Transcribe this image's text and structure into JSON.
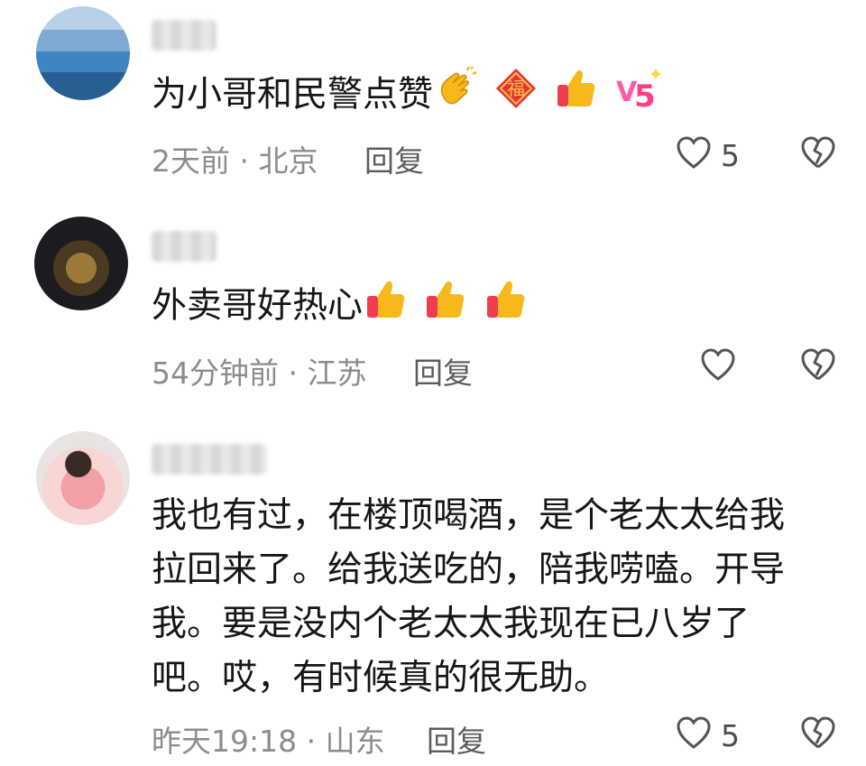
{
  "comments": [
    {
      "username": "",
      "text": "为小哥和民警点赞",
      "emojis": [
        "clapping-hands-icon",
        "fu-diamond-icon",
        "thumbs-up-icon",
        "v5-icon"
      ],
      "time": "2天前",
      "location": "北京",
      "meta": "2天前 · 北京",
      "reply_label": "回复",
      "like_count": "5"
    },
    {
      "username": "",
      "text": "外卖哥好热心",
      "emojis": [
        "thumbs-up-icon",
        "thumbs-up-icon",
        "thumbs-up-icon"
      ],
      "time": "54分钟前",
      "location": "江苏",
      "meta": "54分钟前 · 江苏",
      "reply_label": "回复",
      "like_count": ""
    },
    {
      "username": "",
      "text_lines": [
        "我也有过，在楼顶喝酒，是个老太太给我",
        "拉回来了。给我送吃的，陪我唠嗑。开导",
        "我。要是没内个老太太我现在已八岁了",
        "吧。哎，有时候真的很无助。"
      ],
      "time": "昨天19:18",
      "location": "山东",
      "meta": "昨天19:18 · 山东",
      "reply_label": "回复",
      "like_count": "5"
    }
  ],
  "colors": {
    "text": "#161616",
    "meta": "#8c8c8c",
    "icon": "#555555",
    "thumb": "#f6b81a",
    "thumb_cuff": "#ef3d4d"
  }
}
